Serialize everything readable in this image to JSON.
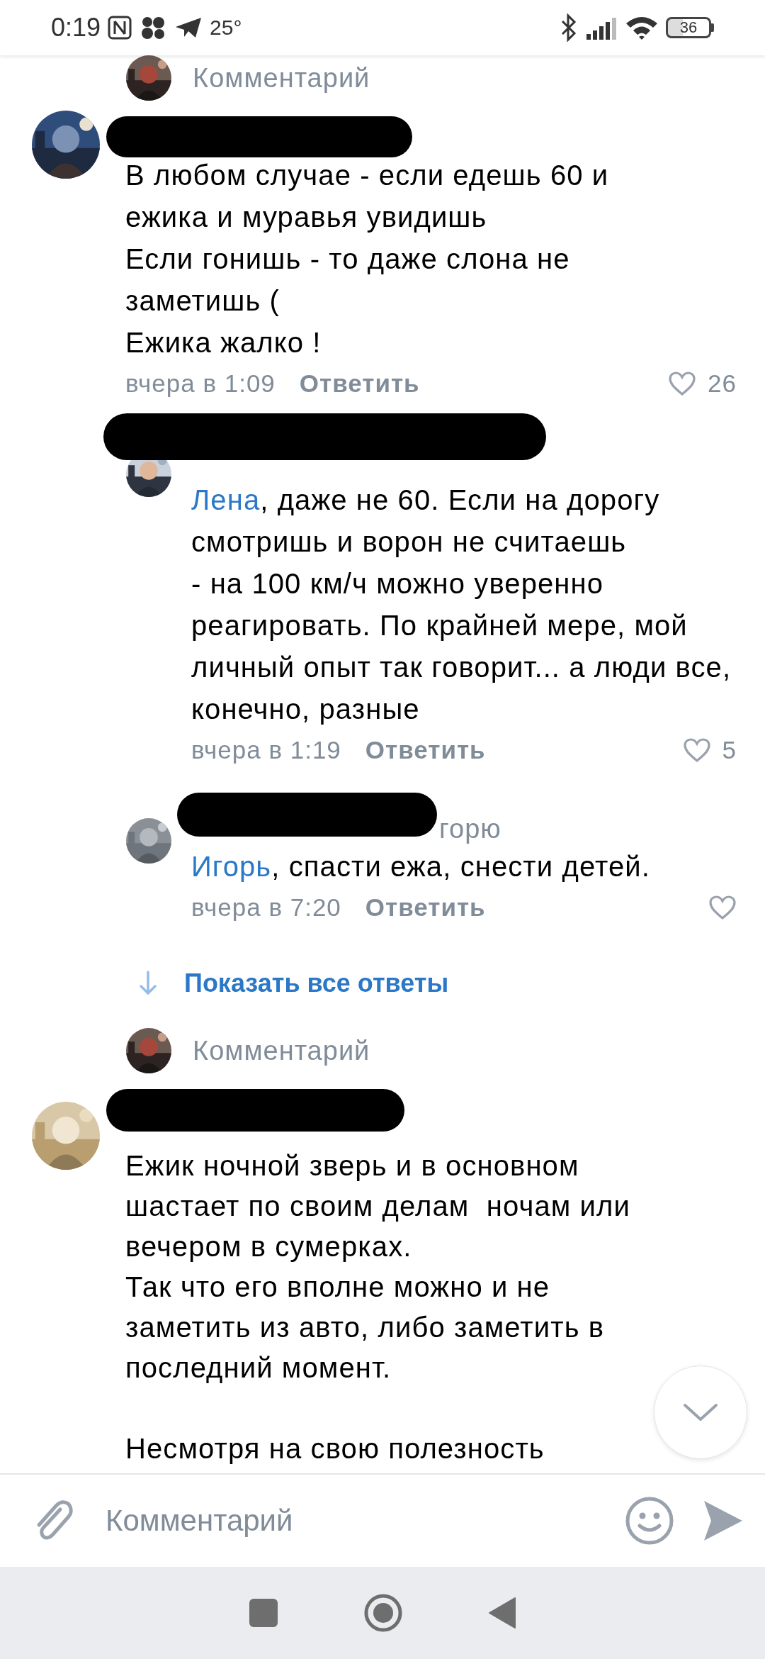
{
  "status_bar": {
    "time": "0:19",
    "temperature": "25°",
    "battery": "36"
  },
  "top_prompt": {
    "placeholder": "Комментарий"
  },
  "comments": [
    {
      "kind": "comment",
      "author_redacted": true,
      "text": "В любом случае - если едешь 60 и\nежика и муравья увидишь\nЕсли гонишь - то даже слона не\nзаметишь (\nЕжика жалко !",
      "time": "вчера в 1:09",
      "reply_label": "Ответить",
      "likes": "26"
    },
    {
      "kind": "reply",
      "author_redacted": true,
      "mention": "Лена",
      "text": ", даже не 60. Если на дорогу смотришь и ворон не считаешь\n- на 100 км/ч можно уверенно реагировать. По крайней мере, мой личный опыт так говорит... а люди все, конечно, разные",
      "time": "вчера в 1:19",
      "reply_label": "Ответить",
      "likes": "5"
    },
    {
      "kind": "reply",
      "author_redacted": true,
      "author_fragment": "горю",
      "mention": "Игорь",
      "text": ", спасти ежа, снести детей.",
      "time": "вчера в 7:20",
      "reply_label": "Ответить"
    }
  ],
  "show_all_replies": "Показать все ответы",
  "reply_prompt": {
    "placeholder": "Комментарий"
  },
  "comments_2": [
    {
      "kind": "comment",
      "author_redacted": true,
      "text": "Ежик ночной зверь и в основном\nшастает по своим делам  ночам или\nвечером в сумерках.\nТак что его вполне можно и не\nзаметить из авто, либо заметить в\nпоследний момент.\n\nНесмотря на свою полезность"
    }
  ],
  "composer": {
    "placeholder": "Комментарий"
  }
}
